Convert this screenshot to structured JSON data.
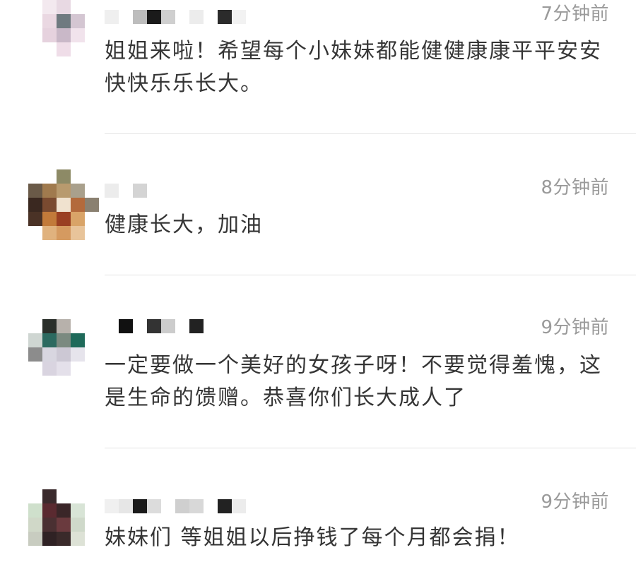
{
  "comments": [
    {
      "time": "7分钟前",
      "text": "姐姐来啦！希望每个小妹妹都能健健康康平平安安快快乐乐长大。"
    },
    {
      "time": "8分钟前",
      "text": "健康长大，加油"
    },
    {
      "time": "9分钟前",
      "text": "一定要做一个美好的女孩子呀！不要觉得羞愧，这是生命的馈赠。恭喜你们长大成人了"
    },
    {
      "time": "9分钟前",
      "text": "妹妹们 等姐姐以后挣钱了每个月都会捐！"
    }
  ],
  "avatar_colors": [
    [
      "#ffffff",
      "#f3e9ef",
      "#e8d9e3",
      "#ffffff",
      "#ffffff",
      "#ffffff",
      "#ead8e2",
      "#6f7a80",
      "#d4c6d2",
      "#ffffff",
      "#ffffff",
      "#e6d2de",
      "#c9b8c8",
      "#f1e3ec",
      "#ffffff",
      "#ffffff",
      "#ffffff",
      "#efdde8",
      "#ffffff",
      "#ffffff"
    ],
    [
      "#ffffff",
      "#ffffff",
      "#8d8a66",
      "#ffffff",
      "#ffffff",
      "#6a5a48",
      "#a07a4e",
      "#b89a6e",
      "#a9a08c",
      "#ffffff",
      "#3a2820",
      "#7a4a30",
      "#f0e2cf",
      "#b36a3c",
      "#8a8070",
      "#4a3226",
      "#c27a3a",
      "#9a3f22",
      "#d9a468",
      "#ffffff",
      "#ffffff",
      "#e0b27e",
      "#d59a60",
      "#e8c49a",
      "#ffffff"
    ],
    [
      "#ffffff",
      "#2a2f2a",
      "#b7b1ab",
      "#ffffff",
      "#ffffff",
      "#cfd6d2",
      "#2c6a60",
      "#7b8a80",
      "#1f6a5a",
      "#ffffff",
      "#8c8c8c",
      "#d8d6e0",
      "#ccc8d4",
      "#e6e4ec",
      "#ffffff",
      "#ffffff",
      "#d9d4e0",
      "#e4e0ea",
      "#ffffff",
      "#ffffff"
    ],
    [
      "#ffffff",
      "#3a2a2c",
      "#ffffff",
      "#ffffff",
      "#ffffff",
      "#cfe0cc",
      "#5a2a30",
      "#3a2628",
      "#d8e4d6",
      "#ffffff",
      "#d0d8c8",
      "#4a3032",
      "#6a3a3e",
      "#cfd9ca",
      "#ffffff",
      "#c8ccc0",
      "#2f2224",
      "#3a2a2a",
      "#dde2d6",
      "#ffffff"
    ]
  ],
  "nick_colors": [
    [
      "#efefef",
      "#ffffff",
      "#bdbdbd",
      "#1a1a1a",
      "#cfcfcf",
      "#ffffff",
      "#ececec",
      "#ffffff",
      "#2b2b2b",
      "#f2f2f2"
    ],
    [
      "#ececec",
      "#ffffff",
      "#d4d4d4"
    ],
    [
      "#ffffff",
      "#111111",
      "#ffffff",
      "#333333",
      "#cccccc",
      "#ffffff",
      "#222222"
    ],
    [
      "#f0f0f0",
      "#e6e6e6",
      "#1a1a1a",
      "#dcdcdc",
      "#ffffff",
      "#cfcfcf",
      "#d8d8d8",
      "#ffffff",
      "#222222",
      "#ececec"
    ]
  ]
}
